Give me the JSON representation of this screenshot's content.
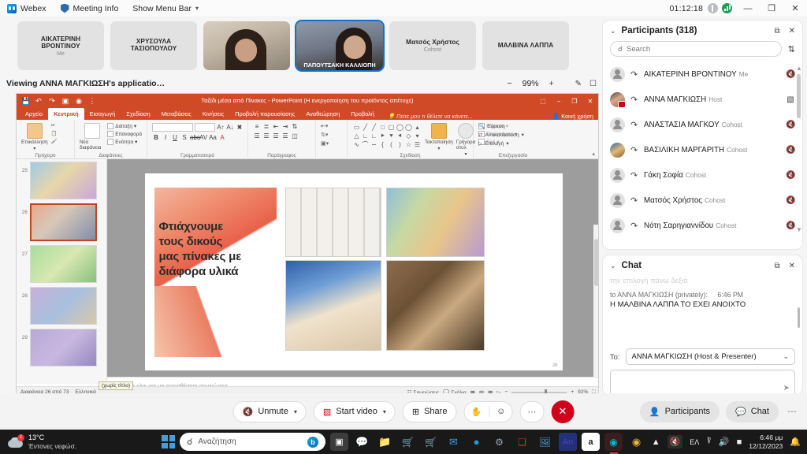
{
  "webex_topbar": {
    "app_name": "Webex",
    "meeting_info": "Meeting Info",
    "show_menu_bar": "Show Menu Bar",
    "elapsed_time": "01:12:18",
    "minimize": "—",
    "maximize": "❐",
    "close": "✕"
  },
  "thumbnails": [
    {
      "name": "ΑΙΚΑΤΕΡΙΝΗ ΒΡΟΝΤΙΝΟΥ",
      "role": "Me",
      "type": "placeholder"
    },
    {
      "name": "ΧΡΥΣΟΥΛΑ ΤΑΣΙΟΠΟΥΛΟΥ",
      "role": "",
      "type": "placeholder"
    },
    {
      "name": "",
      "role": "",
      "type": "video1"
    },
    {
      "name": "ΠΑΠΟΥΤΣΑΚΗ ΚΑΛΛΙΟΠΗ",
      "role": "",
      "type": "video2",
      "active": true
    },
    {
      "name": "Ματσός Χρήστος",
      "role": "Cohost",
      "type": "placeholder"
    },
    {
      "name": "ΜΑΛΒΙΝΑ ΛΑΠΠΑ",
      "role": "",
      "type": "placeholder"
    }
  ],
  "share_header": {
    "title": "Viewing ANNA ΜΑΓΚΙΩΣΗ's applicatio…",
    "zoom_out": "−",
    "zoom_level": "99%",
    "zoom_in": "+"
  },
  "powerpoint": {
    "document_title": "Ταξίδι μέσα από Πίνακες  -  PowerPoint (Η ενεργοποίηση του προϊόντος απέτυχε)",
    "window_controls": {
      "minimize": "−",
      "restore": "❐",
      "close": "✕",
      "ribbon_display": "⬚"
    },
    "tabs": [
      "Αρχείο",
      "Κεντρική",
      "Εισαγωγή",
      "Σχεδίαση",
      "Μεταβάσεις",
      "Κινήσεις",
      "Προβολή παρουσίασης",
      "Αναθεώρηση",
      "Προβολή"
    ],
    "selected_tab": "Κεντρική",
    "tell_me": "Πείτε μου τι θέλετε να κάνετε...",
    "share_label": "Κοινή χρήση",
    "groups": {
      "clipboard": {
        "label": "Πρόχειρο",
        "paste": "Επικόλληση"
      },
      "slides": {
        "label": "Διαφάνειες",
        "new_slide": "Νέα διαφάνεια",
        "items": [
          "Διάταξη",
          "Επαναφορά",
          "Ενότητα"
        ]
      },
      "font": {
        "label": "Γραμματοσειρά"
      },
      "paragraph": {
        "label": "Παράγραφος"
      },
      "drawing": {
        "label": "Σχεδίαση",
        "arrange": "Τακτοποίηση",
        "quick_styles": "Γρήγορα στυλ",
        "items": [
          "Γέμισμα",
          "Περίγραμμα",
          "Εφέ"
        ]
      },
      "editing": {
        "label": "Επεξεργασία",
        "items": [
          "Εύρεση",
          "Αντικατάσταση",
          "Επιλογή"
        ]
      }
    },
    "slide_panel": {
      "numbers": [
        "25",
        "26",
        "27",
        "28",
        "29"
      ],
      "selected": "26",
      "tooltip": "(χωρίς τίτλο)"
    },
    "slide": {
      "title_lines": [
        "Φτιάχνουμε",
        "τους δικούς",
        "μας πίνακες με",
        "διάφορα υλικά"
      ],
      "page_number": "26"
    },
    "notes_placeholder": "Κάντε κλικ για να προσθέσετε σημειώσεις",
    "status_bar": {
      "slide_count": "Διαφάνεια 26 από 73",
      "language": "Ελληνικά",
      "notes": "Σημειώσεις",
      "comments": "Σχόλια",
      "zoom": "92%"
    }
  },
  "participants_panel": {
    "title": "Participants (318)",
    "collapse": "⌄",
    "popout": "⧉",
    "close": "✕",
    "search_placeholder": "Search",
    "search_value": "",
    "sort": "⇅",
    "list": [
      {
        "name": "ΑΙΚΑΤΕΡΙΝΗ ΒΡΟΝΤΙΝΟΥ",
        "role": "Me",
        "muted": true,
        "avatar": "generic"
      },
      {
        "name": "ΑΝΝΑ ΜΑΓΚΙΩΣΗ",
        "role": "Host",
        "muted": false,
        "video": true,
        "avatar": "photo1"
      },
      {
        "name": "ΑΝΑΣΤΑΣΙΑ ΜΑΓΚΟΥ",
        "role": "Cohost",
        "muted": true,
        "avatar": "generic"
      },
      {
        "name": "ΒΑΣΙΛΙΚΗ ΜΑΡΓΑΡΙΤΗ",
        "role": "Cohost",
        "muted": true,
        "avatar": "photo2"
      },
      {
        "name": "Γάκη Σοφία",
        "role": "Cohost",
        "muted": true,
        "avatar": "generic"
      },
      {
        "name": "Ματσός Χρήστος",
        "role": "Cohost",
        "muted": true,
        "avatar": "generic"
      },
      {
        "name": "Νότη Σαρηγιαννίδου",
        "role": "Cohost",
        "muted": true,
        "avatar": "generic"
      }
    ]
  },
  "chat_panel": {
    "title": "Chat",
    "collapse": "⌄",
    "popout": "⧉",
    "close": "✕",
    "clipped_message": "την επιλογή πάνω δεξιά",
    "message": {
      "to_label": "to ANNA ΜΑΓΚΙΩΣΗ (privately):",
      "time": "6:46 PM",
      "text": "Η ΜΑΛΒΙΝΑ ΛΑΠΠΑ ΤΟ ΕΧΕΙ ΑΝΟΙΧΤΟ"
    },
    "to_label": "To:",
    "recipient": "ANNA ΜΑΓΚΙΩΣΗ (Host & Presenter)",
    "chevron": "⌄",
    "input_value": "",
    "send": "➤"
  },
  "control_bar": {
    "unmute": "Unmute",
    "start_video": "Start video",
    "share": "Share",
    "more": "⋯",
    "end": "✕",
    "participants": "Participants",
    "chat": "Chat",
    "right_more": "⋯"
  },
  "taskbar": {
    "weather_temp": "13°C",
    "weather_desc": "Έντονες νεφώσ.",
    "weather_badge": "1",
    "search_placeholder": "Αναζήτηση",
    "apps": [
      "task-view",
      "teams",
      "file-explorer",
      "store",
      "store2",
      "mail",
      "edge",
      "settings-app",
      "acrobat",
      "photos",
      "anydesk",
      "amazon",
      "webex",
      "chrome"
    ],
    "language": "ΕΛ",
    "time": "6:46 μμ",
    "date": "12/12/2023"
  },
  "colors": {
    "powerpoint_orange": "#d04a27",
    "webex_red": "#d0021b",
    "accent_blue": "#1170cf",
    "taskbar": "#191919"
  }
}
